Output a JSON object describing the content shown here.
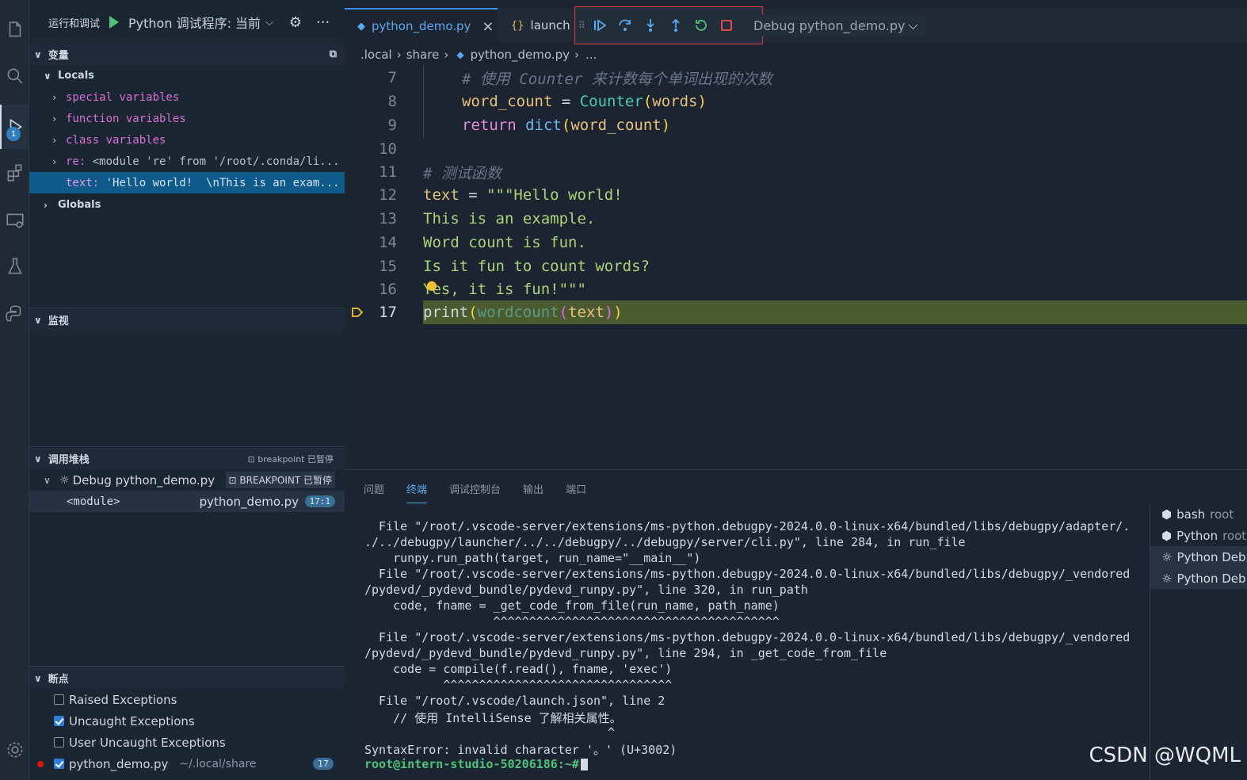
{
  "sidebar": {
    "title": "运行和调试",
    "run_config": "Python 调试程序: 当前",
    "variables_title": "变量",
    "locals_label": "Locals",
    "locals_items": [
      {
        "name": "special variables",
        "value": ""
      },
      {
        "name": "function variables",
        "value": ""
      },
      {
        "name": "class variables",
        "value": ""
      },
      {
        "name": "re:",
        "value": " <module 're' from '/root/.conda/li..."
      },
      {
        "name": "text:",
        "value": " 'Hello world!  \\nThis is an exam..."
      }
    ],
    "globals_label": "Globals",
    "watch_title": "监视",
    "callstack_title": "调用堆栈",
    "callstack_status": "breakpoint 已暂停",
    "session_name": "Debug python_demo.py",
    "session_badge": "BREAKPOINT 已暂停",
    "frame_name": "<module>",
    "frame_file": "python_demo.py",
    "frame_pos": "17:1",
    "breakpoints_title": "断点",
    "breakpoints": [
      {
        "label": "Raised Exceptions",
        "checked": false
      },
      {
        "label": "Uncaught Exceptions",
        "checked": true
      },
      {
        "label": "User Uncaught Exceptions",
        "checked": false
      }
    ],
    "bp_file": "python_demo.py",
    "bp_path": "~/.local/share",
    "bp_line": "17"
  },
  "activity": {
    "debug_badge": "1"
  },
  "editor": {
    "tabs": [
      {
        "label": "python_demo.py",
        "close": "×"
      },
      {
        "label": "launch"
      }
    ],
    "debug_config": "Debug python_demo.py",
    "breadcrumb": [
      ".local",
      "share",
      "python_demo.py",
      "..."
    ],
    "lines": [
      "7",
      "8",
      "9",
      "10",
      "11",
      "12",
      "13",
      "14",
      "15",
      "16",
      "17"
    ],
    "code": {
      "l7": "# 使用 Counter 来计数每个单词出现的次数",
      "l8_a": "word_count",
      "l8_b": " = ",
      "l8_c": "Counter",
      "l8_d": "(",
      "l8_e": "words",
      "l8_f": ")",
      "l9_a": "return",
      "l9_b": "dict",
      "l9_c": "(",
      "l9_d": "word_count",
      "l9_e": ")",
      "l11": "# 测试函数",
      "l12_a": "text",
      "l12_b": " = ",
      "l12_c": "\"\"\"Hello world!",
      "l13": "This is an example.",
      "l14": "Word count is fun.",
      "l15": "Is it fun to count words?",
      "l16": "Yes, it is fun!\"\"\"",
      "l17_a": "print",
      "l17_b": "(",
      "l17_c": "wordcount",
      "l17_d": "(",
      "l17_e": "text",
      "l17_f": ")",
      "l17_g": ")"
    }
  },
  "panel": {
    "tabs": [
      "问题",
      "终端",
      "调试控制台",
      "输出",
      "端口"
    ],
    "terminal_lines": [
      "  File \"/root/.vscode-server/extensions/ms-python.debugpy-2024.0.0-linux-x64/bundled/libs/debugpy/adapter/.",
      "./../debugpy/launcher/../../debugpy/../debugpy/server/cli.py\", line 284, in run_file",
      "    runpy.run_path(target, run_name=\"__main__\")",
      "  File \"/root/.vscode-server/extensions/ms-python.debugpy-2024.0.0-linux-x64/bundled/libs/debugpy/_vendored",
      "/pydevd/_pydevd_bundle/pydevd_runpy.py\", line 320, in run_path",
      "    code, fname = _get_code_from_file(run_name, path_name)",
      "                  ^^^^^^^^^^^^^^^^^^^^^^^^^^^^^^^^^^^^^^^^",
      "  File \"/root/.vscode-server/extensions/ms-python.debugpy-2024.0.0-linux-x64/bundled/libs/debugpy/_vendored",
      "/pydevd/_pydevd_bundle/pydevd_runpy.py\", line 294, in _get_code_from_file",
      "    code = compile(f.read(), fname, 'exec')",
      "           ^^^^^^^^^^^^^^^^^^^^^^^^^^^^^^^^",
      "  File \"/root/.vscode/launch.json\", line 2",
      "    // 使用 IntelliSense 了解相关属性。",
      "                                  ^",
      "SyntaxError: invalid character '。' (U+3002)"
    ],
    "prompt": "root@intern-studio-50206186:~#",
    "terminal_list": [
      {
        "name": "bash",
        "sub": "root"
      },
      {
        "name": "Python",
        "sub": "root"
      },
      {
        "name": "Python Deb",
        "sub": ""
      },
      {
        "name": "Python Deb",
        "sub": ""
      }
    ]
  },
  "watermark": "CSDN @WQML"
}
